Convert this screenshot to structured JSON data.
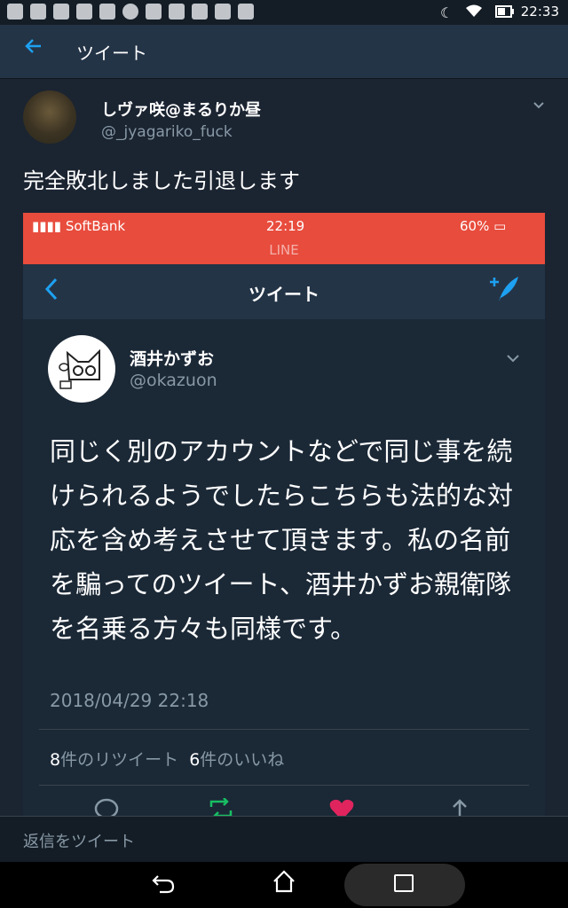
{
  "status_bar": {
    "clock": "22:33"
  },
  "app_bar": {
    "title": "ツイート"
  },
  "tweet": {
    "author_name": "しヴァ咲@まるりか昼",
    "author_handle": "@_jyagariko_fuck",
    "text": "完全敗北しました引退します"
  },
  "embedded": {
    "status": {
      "carrier": "SoftBank",
      "time": "22:19",
      "battery": "60%",
      "app_label": "LINE"
    },
    "header_title": "ツイート",
    "author_name": "酒井かずお",
    "author_handle": "@okazuon",
    "body": "同じく別のアカウントなどで同じ事を続けられるようでしたらこちらも法的な対応を含め考えさせて頂きます。私の名前を騙ってのツイート、酒井かずお親衛隊を名乗る方々も同様です。",
    "date": "2018/04/29 22:18",
    "retweets_count": "8",
    "retweets_label": "件のリツイート",
    "likes_count": "6",
    "likes_label": "件のいいね"
  },
  "reply": {
    "placeholder": "返信をツイート"
  },
  "icons": [
    "back-arrow-icon",
    "caret-down-icon",
    "compose-tweet-icon",
    "reply-icon",
    "retweet-icon",
    "like-icon",
    "share-icon",
    "nav-back-icon",
    "nav-home-icon",
    "nav-recents-icon"
  ],
  "colors": {
    "accent": "#1da1f2",
    "background": "#1b2431",
    "line_status_bar": "#e84c3d",
    "like": "#e0245e",
    "retweet": "#17bf63"
  }
}
